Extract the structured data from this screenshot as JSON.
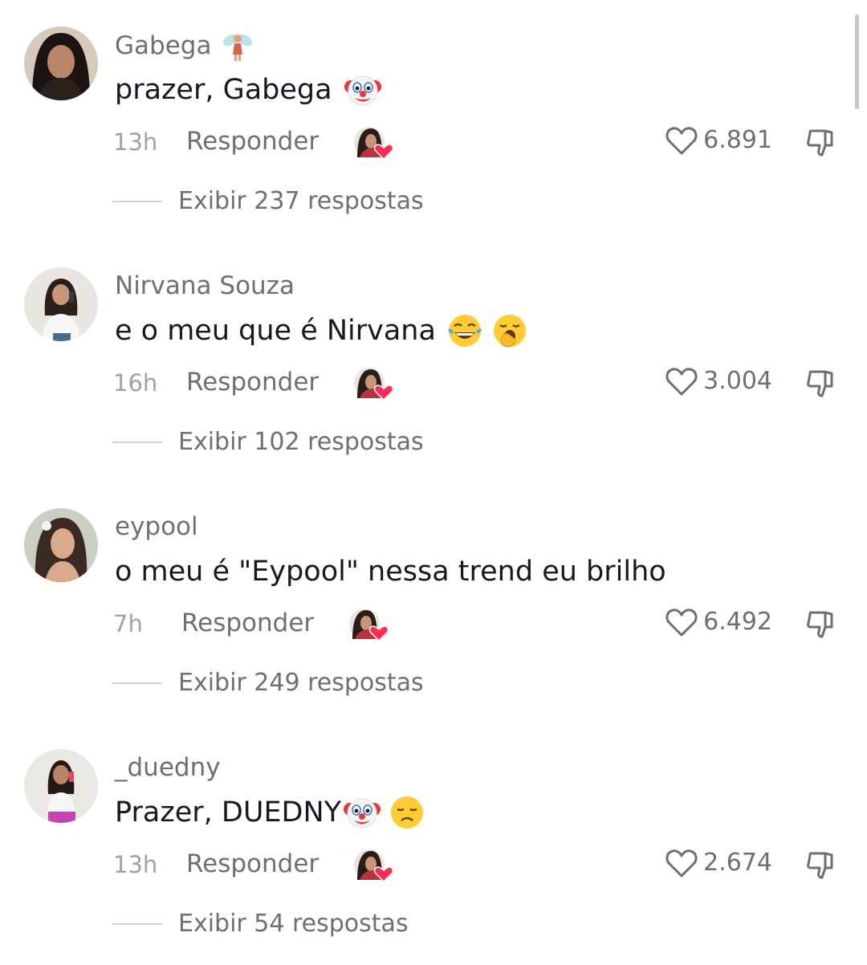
{
  "comments": [
    {
      "username": "Gabega",
      "username_badge_icon": "fairy-emoji",
      "text": "prazer, Gabega",
      "emojis": [
        "clown-face-emoji"
      ],
      "time": "13h",
      "reply_label": "Responder",
      "creator_liked": true,
      "likes": "6.891",
      "view_replies": "Exibir 237 respostas"
    },
    {
      "username": "Nirvana Souza",
      "text": "e o meu que é Nirvana",
      "emojis": [
        "tears-of-joy-emoji",
        "yawning-face-emoji"
      ],
      "time": "16h",
      "reply_label": "Responder",
      "creator_liked": true,
      "likes": "3.004",
      "view_replies": "Exibir 102 respostas"
    },
    {
      "username": "eypool",
      "text": "o meu é \"Eypool\" nessa trend eu brilho",
      "emojis": [],
      "time": "7h",
      "reply_label": "Responder",
      "creator_liked": true,
      "likes": "6.492",
      "view_replies": "Exibir 249 respostas"
    },
    {
      "username": "_duedny",
      "text": "Prazer, DUEDNY",
      "emojis": [
        "clown-face-emoji",
        "disappointed-face-emoji"
      ],
      "time": "13h",
      "reply_label": "Responder",
      "creator_liked": true,
      "likes": "2.674",
      "view_replies": "Exibir 54 respostas"
    }
  ],
  "colors": {
    "primary_text": "#161823",
    "secondary_text": "#6e6e73",
    "time_text": "#a1a2a7",
    "heart_badge": "#fe2c55"
  }
}
